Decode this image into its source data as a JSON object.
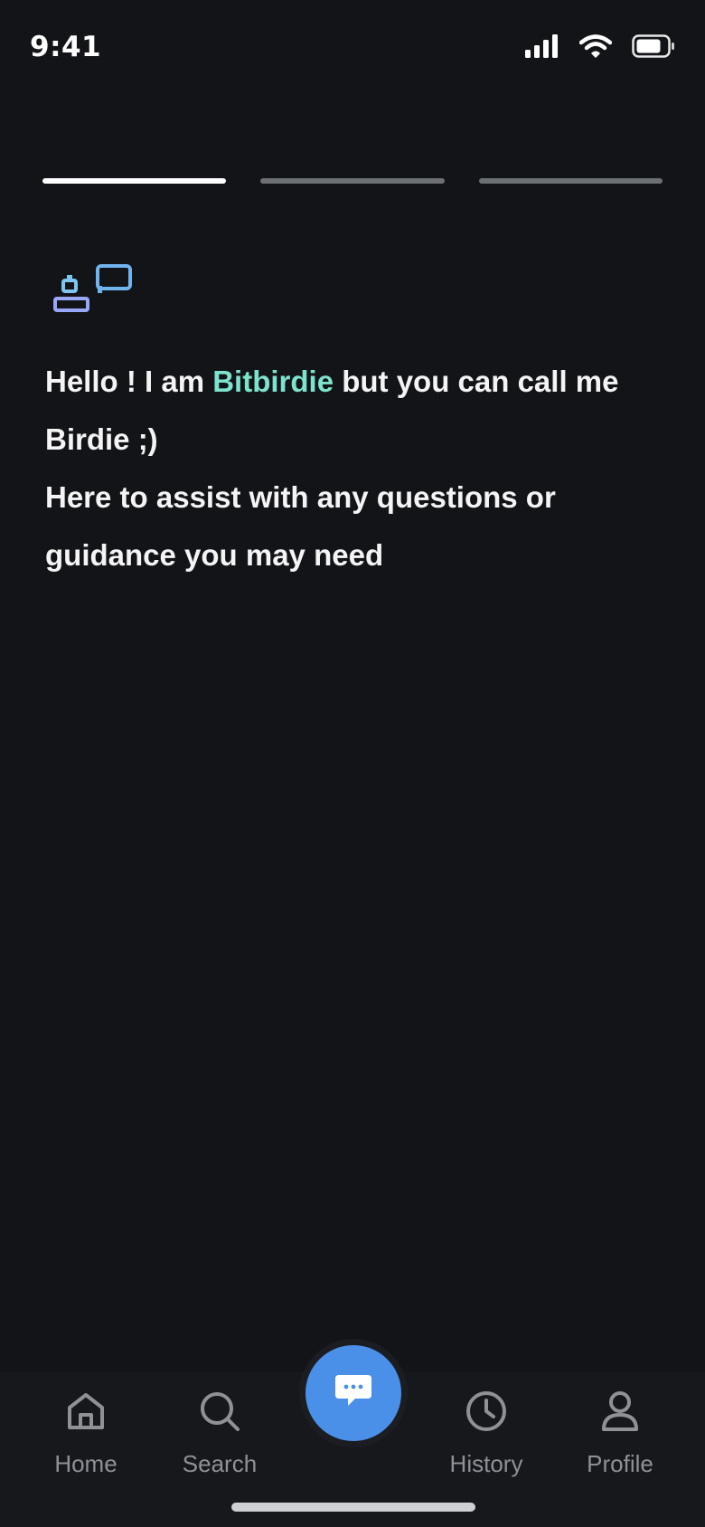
{
  "status_bar": {
    "time": "9:41",
    "icons": [
      "signal-icon",
      "wifi-icon",
      "battery-icon"
    ]
  },
  "progress": {
    "steps": 3,
    "current_step": 1
  },
  "message": {
    "greeting_prefix": "Hello ! I am ",
    "brand_name": "Bitbirdie",
    "greeting_suffix": " but you can call me Birdie ;)",
    "line2": "Here to assist with any questions or guidance you may need"
  },
  "colors": {
    "background": "#121418",
    "brand_accent": "#7ee3cc",
    "fab": "#4a90e8",
    "inactive": "#8e9196"
  },
  "tabbar": {
    "items": [
      {
        "label": "Home",
        "icon": "home-icon"
      },
      {
        "label": "Search",
        "icon": "search-icon"
      },
      {
        "label": "History",
        "icon": "clock-icon"
      },
      {
        "label": "Profile",
        "icon": "person-icon"
      }
    ],
    "center_action_icon": "chat-bubble-icon"
  }
}
